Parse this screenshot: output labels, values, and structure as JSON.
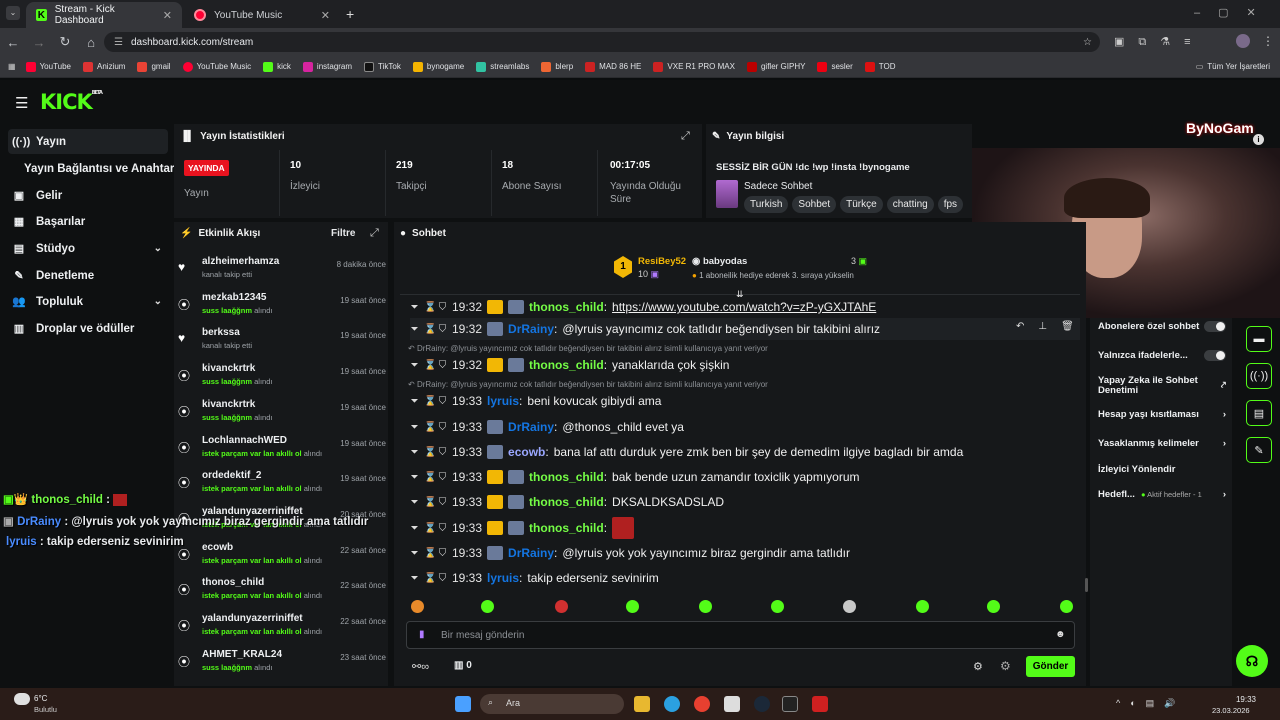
{
  "browser": {
    "tabs": [
      {
        "title": "Stream - Kick Dashboard",
        "active": true
      },
      {
        "title": "YouTube Music",
        "active": false
      }
    ],
    "url": "dashboard.kick.com/stream",
    "bookmarks": [
      "YouTube",
      "Anizium",
      "gmail",
      "YouTube Music",
      "kick",
      "instagram",
      "TikTok",
      "bynogame",
      "streamlabs",
      "blerp",
      "MAD 86 HE",
      "VXE R1 PRO MAX",
      "gifler GIPHY",
      "sesler",
      "TOD"
    ],
    "all_bookmarks": "Tüm Yer İşaretleri"
  },
  "kick": {
    "logo": "KICK",
    "beta": "BETA"
  },
  "nav": {
    "items": [
      {
        "label": "Yayın",
        "icon": "broadcast-icon"
      },
      {
        "label": "Yayın Bağlantısı ve Anahtarı"
      },
      {
        "label": "Gelir",
        "icon": "wallet-icon"
      },
      {
        "label": "Başarılar",
        "icon": "trophy-icon"
      },
      {
        "label": "Stüdyo",
        "icon": "studio-icon"
      },
      {
        "label": "Denetleme",
        "icon": "wrench-icon"
      },
      {
        "label": "Topluluk",
        "icon": "people-icon"
      },
      {
        "label": "Droplar ve ödüller",
        "icon": "gift-icon"
      }
    ]
  },
  "stats": {
    "title": "Yayın İstatistikleri",
    "live": "YAYINDA",
    "live_label": "Yayın",
    "viewers": "10",
    "viewers_label": "İzleyici",
    "followers": "219",
    "followers_label": "Takipçi",
    "subs": "18",
    "subs_label": "Abone Sayısı",
    "uptime": "00:17:05",
    "uptime_label": "Yayında Olduğu Süre"
  },
  "info": {
    "title": "Yayın bilgisi",
    "stream_title": "SESSİZ BİR GÜN !dc !wp !insta !bynogame",
    "category": "Sadece Sohbet",
    "tags": [
      "Turkish",
      "Sohbet",
      "Türkçe",
      "chatting",
      "fps"
    ]
  },
  "activity": {
    "title": "Etkinlik Akışı",
    "filter": "Filtre",
    "items": [
      {
        "name": "alzheimerhamza",
        "sub": "kanalı takip etti",
        "time": "8 dakika önce",
        "kind": "follow"
      },
      {
        "name": "mezkab12345",
        "sub_b": "suss laağğnm",
        "sub": "alındı",
        "time": "19 saat önce",
        "kind": "reward"
      },
      {
        "name": "berkssa",
        "sub": "kanalı takip etti",
        "time": "19 saat önce",
        "kind": "follow"
      },
      {
        "name": "kivanckrtrk",
        "sub_b": "suss laağğnm",
        "sub": "alındı",
        "time": "19 saat önce",
        "kind": "reward"
      },
      {
        "name": "kivanckrtrk",
        "sub_b": "suss laağğnm",
        "sub": "alındı",
        "time": "19 saat önce",
        "kind": "reward"
      },
      {
        "name": "LochlannachWED",
        "sub_b": "istek parçam var lan akıllı ol",
        "sub": "alındı",
        "time": "19 saat önce",
        "kind": "reward"
      },
      {
        "name": "ordedektif_2",
        "sub_b": "istek parçam var lan akıllı ol",
        "sub": "alındı",
        "time": "19 saat önce",
        "kind": "reward"
      },
      {
        "name": "yalandunyazerriniffet",
        "sub_b": "istek parçam var lan akıllı ol",
        "sub": "alındı",
        "time": "20 saat önce",
        "kind": "reward"
      },
      {
        "name": "ecowb",
        "sub_b": "istek parçam var lan akıllı ol",
        "sub": "alındı",
        "time": "22 saat önce",
        "kind": "reward"
      },
      {
        "name": "thonos_child",
        "sub_b": "istek parçam var lan akıllı ol",
        "sub": "alındı",
        "time": "22 saat önce",
        "kind": "reward"
      },
      {
        "name": "yalandunyazerriniffet",
        "sub_b": "istek parçam var lan akıllı ol",
        "sub": "alındı",
        "time": "22 saat önce",
        "kind": "reward"
      },
      {
        "name": "AHMET_KRAL24",
        "sub_b": "suss laağğnm",
        "sub": "alındı",
        "time": "23 saat önce",
        "kind": "reward"
      }
    ]
  },
  "chat": {
    "title": "Sohbet",
    "leaders": {
      "first_name": "ResiBey52",
      "first_count": "10",
      "second_name": "babyodas",
      "second_count": "3",
      "gift_text": "1 aboneilik hediye ederek 3. sıraya yükselin"
    },
    "messages": [
      {
        "time": "19:32",
        "user": "thonos_child",
        "color": "#75fd46",
        "crown": true,
        "text": "https://www.youtube.com/watch?v=zP-yGXJTAhE",
        "link": true
      },
      {
        "time": "19:32",
        "user": "DrRainy",
        "color": "#1475e1",
        "text": "@lyruis yayıncımız cok tatlıdır beğendiysen bir takibini alırız"
      },
      {
        "time": "19:32",
        "user": "thonos_child",
        "color": "#75fd46",
        "crown": true,
        "text": "yanaklarıda çok şişkin",
        "reply": "DrRainy: @lyruis yayıncımız cok tatlıdır beğendiysen bir takibini alırız isimli kullanıcıya yanıt veriyor"
      },
      {
        "time": "19:33",
        "user": "lyruis",
        "color": "#1475e1",
        "text": "beni kovucak gibiydi ama",
        "reply": "DrRainy: @lyruis yayıncımız cok tatlıdır beğendiysen bir takibini alırız isimli kullanıcıya yanıt veriyor"
      },
      {
        "time": "19:33",
        "user": "DrRainy",
        "color": "#1475e1",
        "text": "@thonos_child evet ya"
      },
      {
        "time": "19:33",
        "user": "ecowb",
        "color": "#9aa7ff",
        "text": "bana laf attı durduk yere zmk ben bir şey de demedim ilgiye bagladı bir amda"
      },
      {
        "time": "19:33",
        "user": "thonos_child",
        "color": "#75fd46",
        "crown": true,
        "text": "bak bende uzun zamandır toxiclik yapmıyorum"
      },
      {
        "time": "19:33",
        "user": "thonos_child",
        "color": "#75fd46",
        "crown": true,
        "text": "DKSALDKSADSLAD"
      },
      {
        "time": "19:33",
        "user": "thonos_child",
        "color": "#75fd46",
        "crown": true,
        "text": ""
      },
      {
        "time": "19:33",
        "user": "DrRainy",
        "color": "#1475e1",
        "text": "@lyruis yok yok yayıncımız biraz gergindir ama tatlıdır"
      },
      {
        "time": "19:33",
        "user": "lyruis",
        "color": "#1475e1",
        "text": "takip ederseniz sevinirim"
      }
    ],
    "input_placeholder": "Bir mesaj gönderin",
    "send": "Gönder",
    "count": "0"
  },
  "overlay": {
    "lines": [
      {
        "user": "thonos_child",
        "text": ""
      },
      {
        "user": "DrRainy",
        "text": "@lyruis yok yok yayıncımız biraz gergindir ama tatlıdır"
      },
      {
        "user": "lyruis",
        "text": "takip ederseniz sevinirim"
      }
    ]
  },
  "stream_overlay_brand": "ByNoGam",
  "settings": {
    "items": [
      "Abonelere özel sohbet",
      "Yalnızca ifadelerle...",
      "Yapay Zeka ile Sohbet Denetimi",
      "Hesap yaşı kısıtlaması",
      "Yasaklanmış kelimeler",
      "İzleyici Yönlendir",
      "Hedefl...",
      "Aktif hedefler - 1"
    ]
  },
  "taskbar": {
    "weather_temp": "6°C",
    "weather_desc": "Bulutlu",
    "search": "Ara",
    "time": "19:33",
    "date": "23.03.2026"
  },
  "colors": {
    "accent": "#53fc18",
    "live": "#e9131f"
  }
}
